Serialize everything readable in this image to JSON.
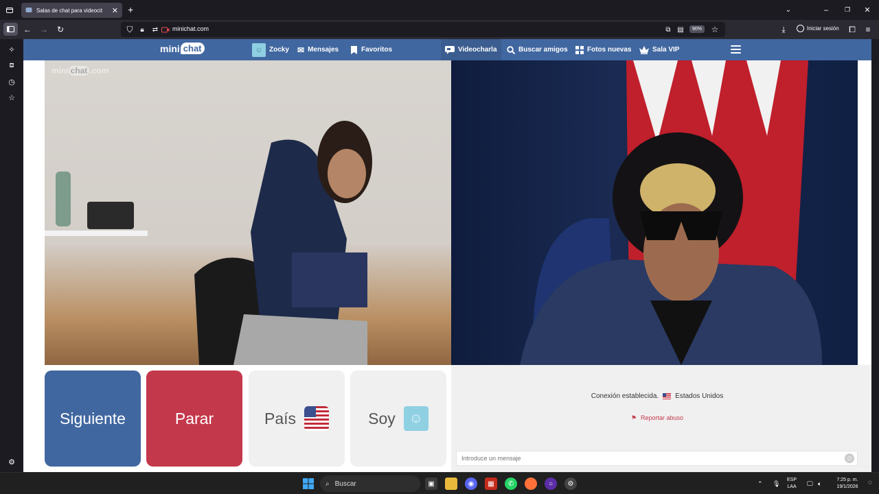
{
  "browser": {
    "tab_title": "Salas de chat para videocit",
    "url": "minichat.com",
    "zoom": "90%",
    "signin_label": "Iniciar sesión"
  },
  "header": {
    "logo_mini": "mini",
    "logo_chat": "chat",
    "nav": [
      {
        "label": "Zocky",
        "icon": "user-avatar-icon"
      },
      {
        "label": "Mensajes",
        "icon": "envelope-icon"
      },
      {
        "label": "Favoritos",
        "icon": "bookmark-icon"
      },
      {
        "label": "Videocharla",
        "icon": "chat-bubble-icon",
        "active": true
      },
      {
        "label": "Buscar amigos",
        "icon": "search-icon"
      },
      {
        "label": "Fotos nuevas",
        "icon": "grid-icon"
      },
      {
        "label": "Sala VIP",
        "icon": "crown-icon"
      }
    ]
  },
  "video": {
    "watermark_mini": "mini",
    "watermark_chat": "chat",
    "watermark_domain": ".com"
  },
  "controls": {
    "next_label": "Siguiente",
    "stop_label": "Parar",
    "country_label": "País",
    "me_label": "Soy"
  },
  "chat": {
    "connection_text": "Conexión establecida.",
    "country": "Estados Unidos",
    "report_label": "Reportar abuso",
    "input_placeholder": "Introduce un mensaje"
  },
  "taskbar": {
    "search_label": "Buscar",
    "lang_top": "ESP",
    "lang_bottom": "LAA",
    "time": "7:25 p. m.",
    "date": "19/1/2026"
  },
  "colors": {
    "header_blue": "#4167a0",
    "stop_red": "#c4384b",
    "avatar_teal": "#8fd0e3"
  }
}
